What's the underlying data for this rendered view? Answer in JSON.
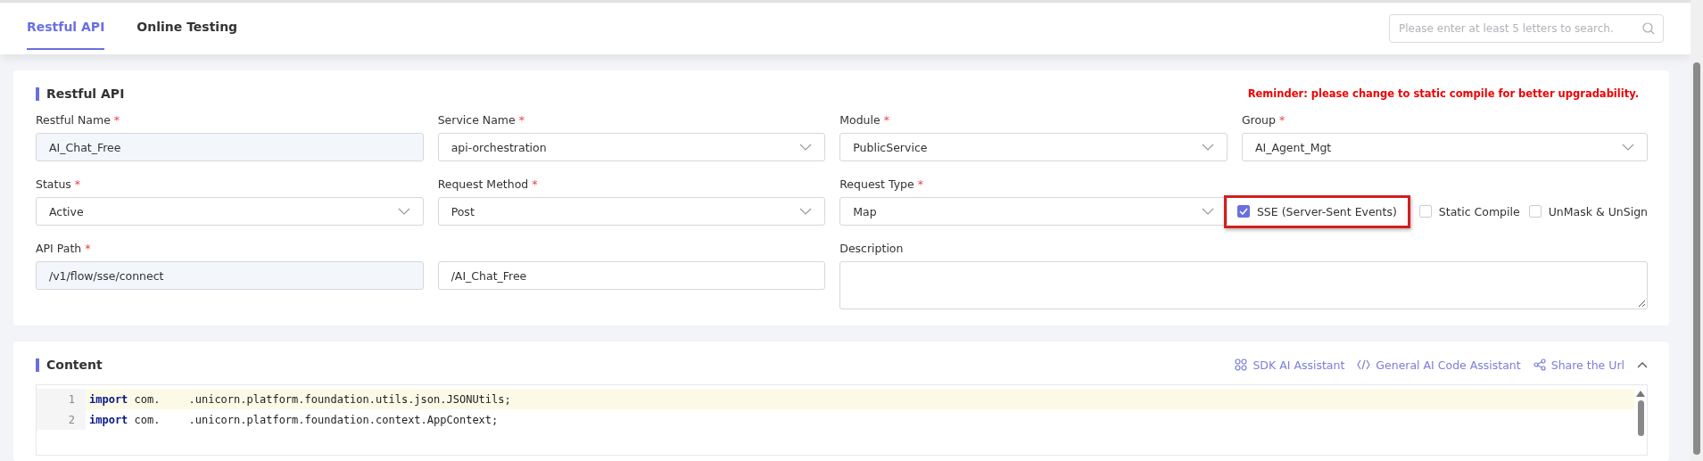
{
  "tabs": [
    {
      "label": "Restful API",
      "selected": true
    },
    {
      "label": "Online Testing",
      "selected": false
    }
  ],
  "search": {
    "placeholder": "Please enter at least 5 letters to search."
  },
  "form_section": {
    "title": "Restful API",
    "reminder": "Reminder: please change to static compile for better upgradability.",
    "fields": [
      {
        "kind": "text",
        "label": "Restful Name",
        "required_mark": "*",
        "value": "AI_Chat_Free",
        "readonly": true
      },
      {
        "kind": "select",
        "label": "Service Name",
        "required_mark": "*",
        "value": "api-orchestration"
      },
      {
        "kind": "select",
        "label": "Module",
        "required_mark": "*",
        "value": "PublicService"
      },
      {
        "kind": "select",
        "label": "Group",
        "required_mark": "*",
        "value": "AI_Agent_Mgt"
      },
      {
        "kind": "select",
        "label": "Status",
        "required_mark": "*",
        "value": "Active"
      },
      {
        "kind": "select",
        "label": "Request Method",
        "required_mark": "*",
        "value": "Post"
      },
      {
        "kind": "select",
        "label": "Request Type",
        "required_mark": "*",
        "value": "Map"
      },
      {
        "kind": "checks",
        "options": [
          {
            "label": "SSE (Server-Sent Events)",
            "checked": true,
            "highlighted": true
          },
          {
            "label": "Static Compile",
            "checked": false,
            "highlighted": false
          },
          {
            "label": "UnMask & UnSign",
            "checked": false,
            "highlighted": false
          }
        ]
      },
      {
        "kind": "text",
        "label": "API Path",
        "required_mark": "*",
        "value": "/v1/flow/sse/connect",
        "readonly": true
      },
      {
        "kind": "text",
        "value": "/AI_Chat_Free",
        "readonly": false
      },
      {
        "kind": "textarea",
        "label": "Description"
      }
    ]
  },
  "content_section": {
    "title": "Content",
    "actions": [
      {
        "label": "SDK AI Assistant"
      },
      {
        "label": "General AI Code Assistant"
      },
      {
        "label": "Share the Url"
      }
    ],
    "code_lines": [
      {
        "number": "1",
        "keyword": "import",
        "parts": [
          "com.",
          ".unicorn.platform.foundation.utils.json.JSONUtils;"
        ],
        "highlighted": true
      },
      {
        "number": "2",
        "keyword": "import",
        "parts": [
          "com.",
          ".unicorn.platform.foundation.context.AppContext;"
        ],
        "highlighted": false
      }
    ]
  }
}
